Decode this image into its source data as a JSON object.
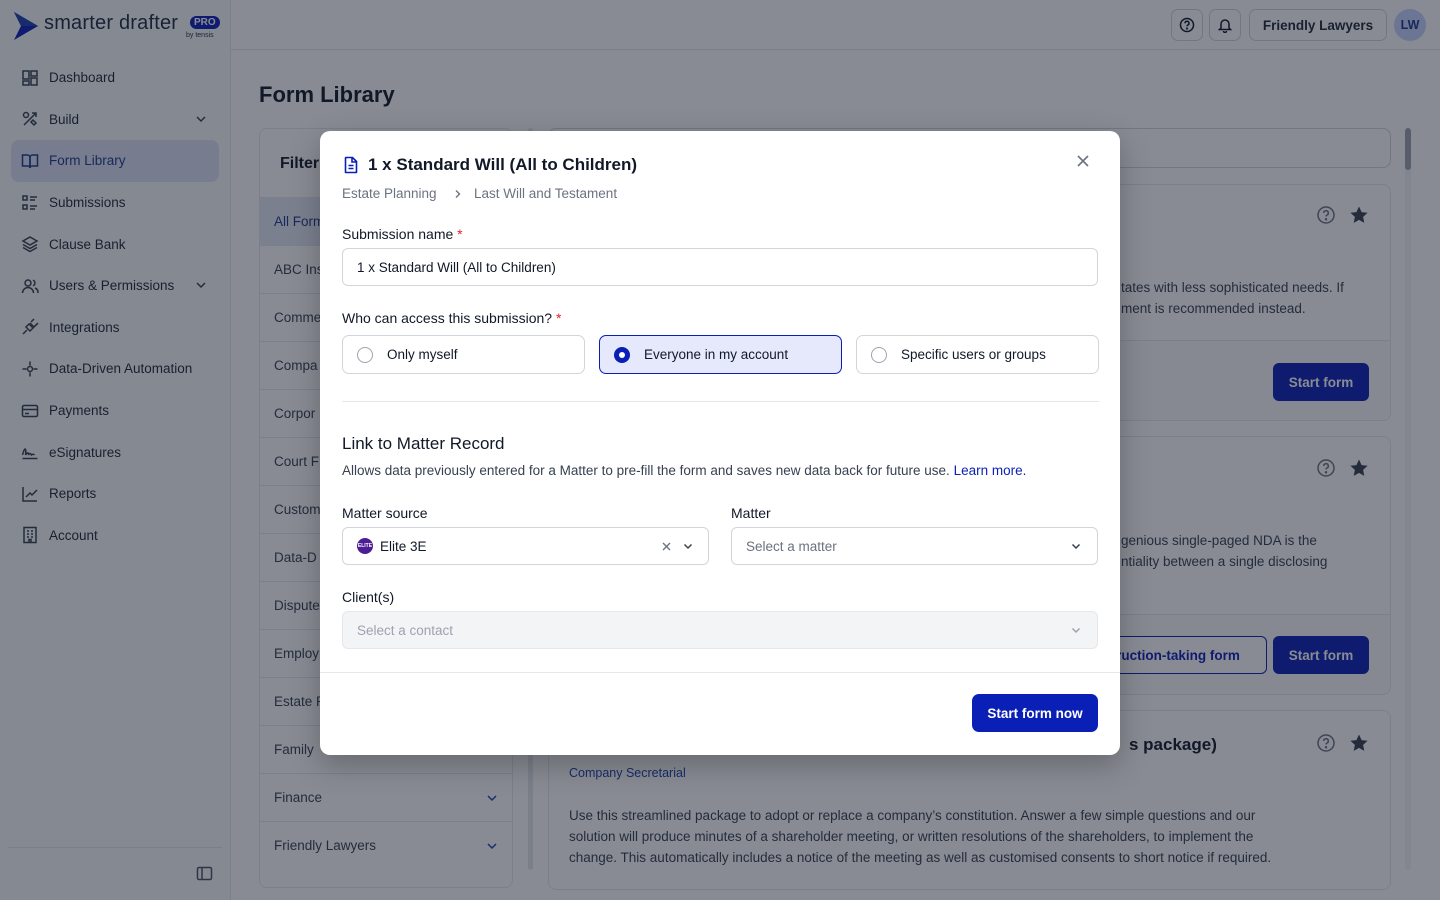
{
  "brand": {
    "name": "smarter drafter",
    "badge": "PRO",
    "byline": "by tensis"
  },
  "sidebar": {
    "items": [
      {
        "label": "Dashboard",
        "icon": "dashboard-icon"
      },
      {
        "label": "Build",
        "icon": "build-icon",
        "expandable": true
      },
      {
        "label": "Form Library",
        "icon": "book-icon",
        "active": true
      },
      {
        "label": "Submissions",
        "icon": "list-icon"
      },
      {
        "label": "Clause Bank",
        "icon": "layers-icon"
      },
      {
        "label": "Users & Permissions",
        "icon": "users-icon",
        "expandable": true
      },
      {
        "label": "Integrations",
        "icon": "plug-icon"
      },
      {
        "label": "Data-Driven Automation",
        "icon": "automation-icon"
      },
      {
        "label": "Payments",
        "icon": "card-icon"
      },
      {
        "label": "eSignatures",
        "icon": "signature-icon"
      },
      {
        "label": "Reports",
        "icon": "chart-icon"
      },
      {
        "label": "Account",
        "icon": "building-icon"
      }
    ]
  },
  "topbar": {
    "org_name": "Friendly Lawyers",
    "avatar_initials": "LW"
  },
  "page": {
    "title": "Form Library"
  },
  "filters": {
    "title": "Filter",
    "categories": [
      "All Forms",
      "ABC Ins",
      "Comme",
      "Compa",
      "Corpor",
      "Court F",
      "Custom",
      "Data-D",
      "Dispute",
      "Employ",
      "Estate P",
      "Family",
      "Finance",
      "Friendly Lawyers"
    ]
  },
  "cards": [
    {
      "desc_line1": "tates with less sophisticated needs. If",
      "desc_line2": "ment is recommended instead.",
      "button": "Start form"
    },
    {
      "desc_line1": "genious single-paged NDA is the",
      "desc_line2": "ntiality between a single disclosing",
      "secondary_button": "ruction-taking form",
      "button": "Start form"
    },
    {
      "title_fragment": "s package)",
      "category": "Company Secretarial",
      "desc": [
        "Use this streamlined package to adopt or replace a company’s constitution. Answer a few simple questions and our",
        "solution will produce minutes of a shareholder meeting, or written resolutions of the shareholders, to implement the",
        "change. This automatically includes a notice of the meeting as well as customised consents to short notice if required."
      ]
    }
  ],
  "modal": {
    "title": "1 x Standard Will (All to Children)",
    "breadcrumb": [
      "Estate Planning",
      "Last Will and Testament"
    ],
    "submission_name_label": "Submission name",
    "required_mark": "*",
    "submission_name_value": "1 x Standard Will (All to Children)",
    "access_label": "Who can access this submission?",
    "access_options": [
      "Only myself",
      "Everyone in my account",
      "Specific users or groups"
    ],
    "access_selected": "Everyone in my account",
    "matter_section_title": "Link to Matter Record",
    "matter_section_desc": "Allows data previously entered for a Matter to pre-fill the form and saves new data back for future use.",
    "learn_more": "Learn more.",
    "matter_source_label": "Matter source",
    "matter_source_value": "Elite 3E",
    "matter_source_logo": "ELITE",
    "matter_label": "Matter",
    "matter_placeholder": "Select a matter",
    "clients_label": "Client(s)",
    "clients_placeholder": "Select a contact",
    "submit_button": "Start form now"
  },
  "colors": {
    "primary": "#0a1fb5",
    "overlay": "rgba(17,24,39,0.5)",
    "required": "#dc2626"
  }
}
